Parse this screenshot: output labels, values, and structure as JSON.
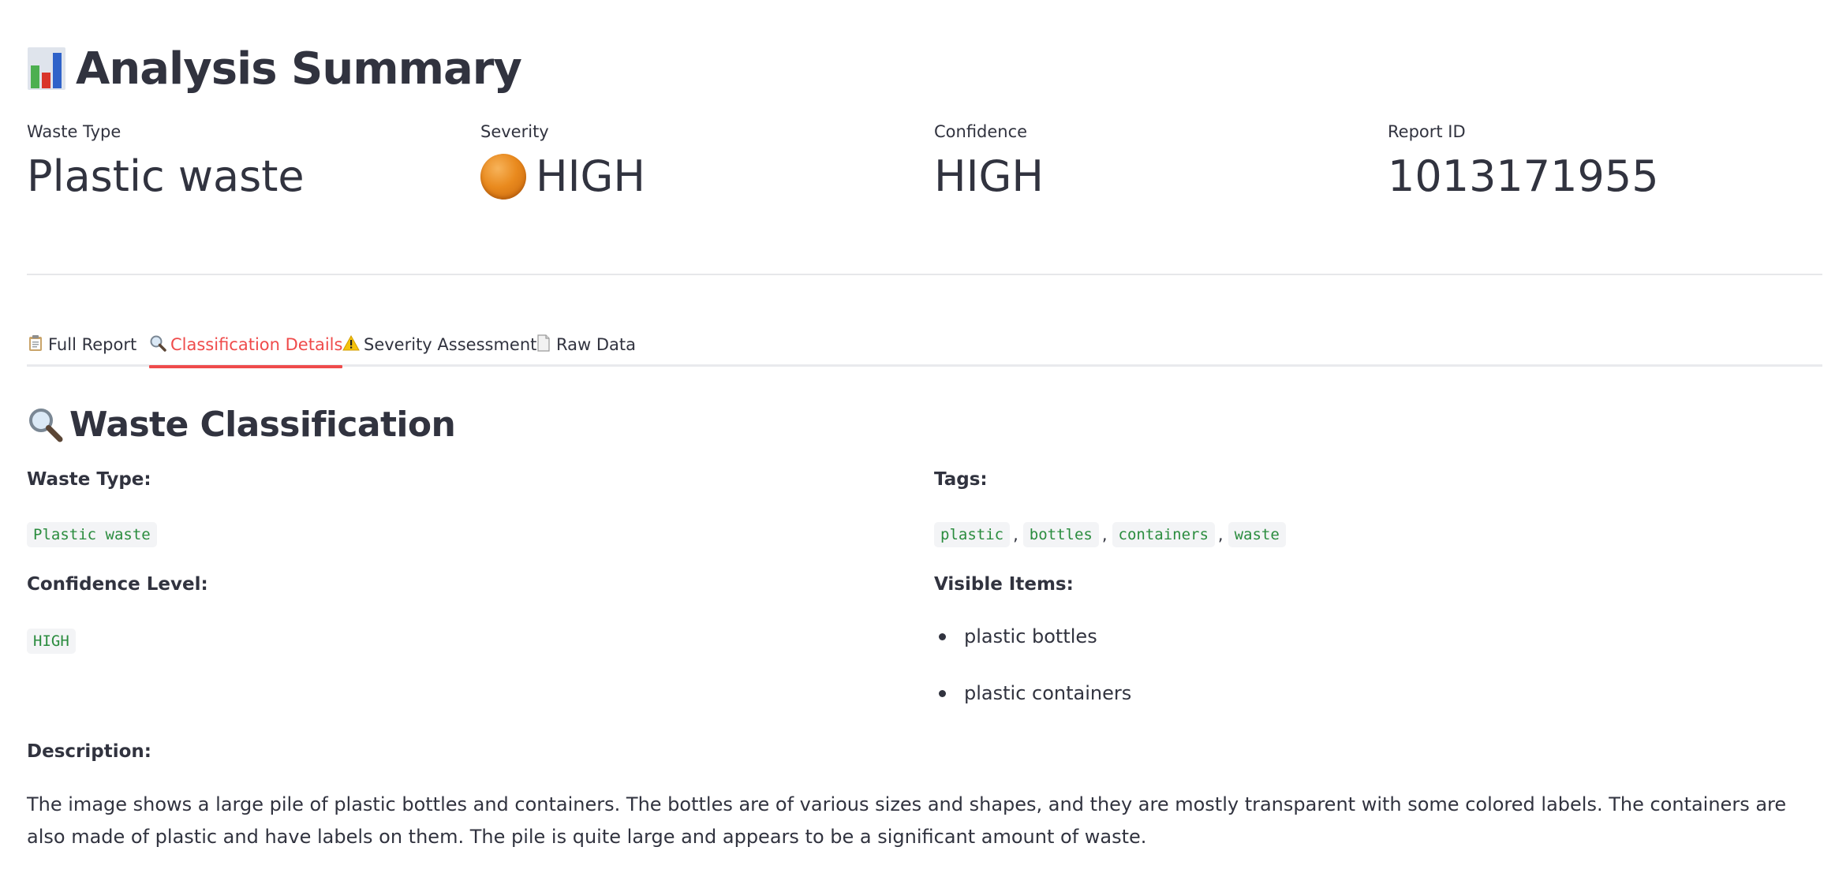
{
  "summary": {
    "title": "Analysis Summary",
    "title_icon": "bar-chart-icon",
    "metrics": [
      {
        "label": "Waste Type",
        "value": "Plastic waste"
      },
      {
        "label": "Severity",
        "value": "HIGH",
        "icon": "orange-circle-icon",
        "icon_color": "#e98a1e"
      },
      {
        "label": "Confidence",
        "value": "HIGH"
      },
      {
        "label": "Report ID",
        "value": "1013171955"
      }
    ]
  },
  "tabs": [
    {
      "label": "Full Report",
      "icon": "clipboard-icon",
      "active": false
    },
    {
      "label": "Classification Details",
      "icon": "magnifier-icon",
      "active": true
    },
    {
      "label": "Severity Assessment",
      "icon": "warning-icon",
      "active": false
    },
    {
      "label": "Raw Data",
      "icon": "document-icon",
      "active": false
    }
  ],
  "classification": {
    "title": "Waste Classification",
    "title_icon": "magnifier-icon",
    "waste_type_label": "Waste Type:",
    "waste_type_value": "Plastic waste",
    "confidence_label": "Confidence Level:",
    "confidence_value": "HIGH",
    "tags_label": "Tags:",
    "tags": [
      "plastic",
      "bottles",
      "containers",
      "waste"
    ],
    "tag_separator": ",",
    "visible_items_label": "Visible Items:",
    "visible_items": [
      "plastic bottles",
      "plastic containers"
    ],
    "description_label": "Description:",
    "description": "The image shows a large pile of plastic bottles and containers. The bottles are of various sizes and shapes, and they are mostly transparent with some colored labels. The containers are also made of plastic and have labels on them. The pile is quite large and appears to be a significant amount of waste."
  },
  "colors": {
    "accent": "#ef4b4b",
    "text": "#31333f",
    "code_text": "#2a8c3e",
    "code_bg": "#f3f4f6",
    "divider": "#e6e7ea"
  }
}
